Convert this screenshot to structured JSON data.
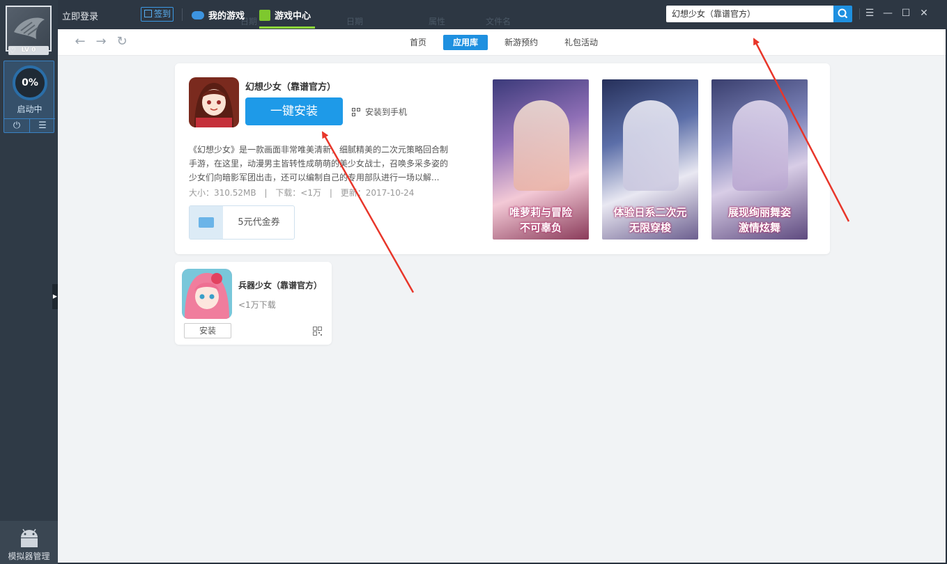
{
  "sidebar": {
    "level": "LV 0",
    "progress": "0%",
    "status": "启动中",
    "power_icon": "⏻",
    "menu_icon": "☰",
    "emulator_manage": "模拟器管理"
  },
  "topbar": {
    "login": "立即登录",
    "checkin": "签到",
    "my_games": "我的游戏",
    "game_center": "游戏中心",
    "search_value": "幻想少女（靠谱官方）",
    "ghost_texts": [
      "日期",
      "属性",
      "文件名"
    ]
  },
  "nav": {
    "tabs": [
      {
        "label": "首页",
        "active": false
      },
      {
        "label": "应用库",
        "active": true
      },
      {
        "label": "新游预约",
        "active": false
      },
      {
        "label": "礼包活动",
        "active": false
      }
    ]
  },
  "app": {
    "title": "幻想少女（靠谱官方）",
    "install": "一键安装",
    "install_phone": "安装到手机",
    "description": "《幻想少女》是一款画面非常唯美清新，细腻精美的二次元策略回合制手游，在这里，动漫男主皆转性成萌萌的美少女战士，召唤多采多姿的少女们向暗影军团出击，还可以编制自己的专用部队进行一场以解...",
    "size": "大小：310.52MB",
    "downloads": "下载：<1万",
    "updated": "更新：2017-10-24",
    "coupon": "5元代金券",
    "screenshots": [
      {
        "caption1": "唯萝莉与冒险",
        "caption2": "不可辜负"
      },
      {
        "caption1": "体验日系二次元",
        "caption2": "无限穿梭"
      },
      {
        "caption1": "展现绚丽舞姿",
        "caption2": "激情炫舞"
      }
    ]
  },
  "related": {
    "title": "兵器少女（靠谱官方）",
    "downloads": "<1万下载",
    "install": "安装"
  },
  "colors": {
    "accent": "#1e90e0",
    "annotation": "#e8362a"
  }
}
